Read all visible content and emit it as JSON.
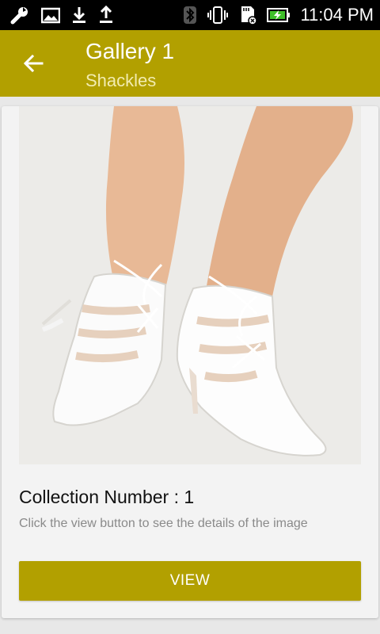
{
  "status_bar": {
    "time": "11:04 PM",
    "left_icons": [
      "wrench-icon",
      "image-icon",
      "download-icon",
      "upload-icon"
    ],
    "right_icons": [
      "bluetooth-icon",
      "vibrate-icon",
      "sd-card-icon",
      "battery-charging-icon"
    ]
  },
  "app_bar": {
    "title": "Gallery 1",
    "subtitle": "Shackles",
    "back_icon": "arrow-left-icon",
    "color": "#b2a000"
  },
  "card": {
    "image_subject": "white lace-up pointed heels",
    "title": "Collection Number : 1",
    "description": "Click the view button to see the details of the image",
    "button_label": "VIEW",
    "button_color": "#b2a000"
  }
}
